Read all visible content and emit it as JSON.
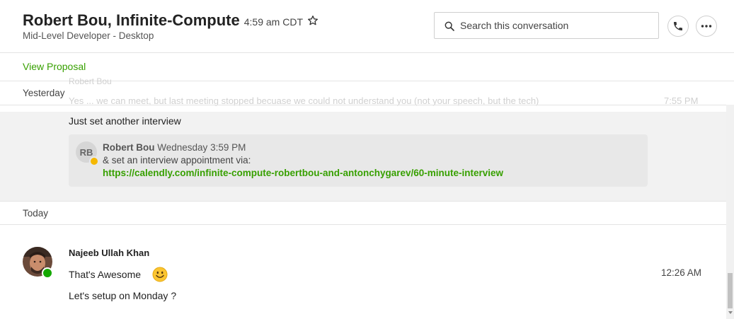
{
  "header": {
    "title": "Robert Bou, Infinite-Compute",
    "time": "4:59 am CDT",
    "subtitle": "Mid-Level Developer - Desktop",
    "search_placeholder": "Search this conversation"
  },
  "proposal": {
    "link_label": "View Proposal"
  },
  "ghost": {
    "sender": "Robert Bou",
    "text": "Yes ... we can meet, but last meeting stopped becuase we could not understand you (not your speech, but the tech)",
    "time": "7:55 PM"
  },
  "yesterday": {
    "label": "Yesterday",
    "message": "Just set another interview",
    "quote": {
      "initials": "RB",
      "sender": "Robert Bou",
      "timestamp": "Wednesday 3:59 PM",
      "text": "& set an interview appointment via:",
      "link": "https://calendly.com/infinite-compute-robertbou-and-antonchygarev/60-minute-interview"
    }
  },
  "today": {
    "label": "Today",
    "sender": "Najeeb Ullah Khan",
    "time": "12:26 AM",
    "line1": "That's Awesome",
    "line2": "Let's setup on Monday ?"
  },
  "colors": {
    "accent": "#37a000",
    "online": "#14a800",
    "away": "#f5b800"
  }
}
